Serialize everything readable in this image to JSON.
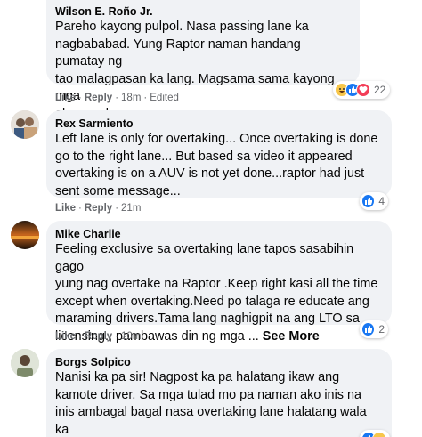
{
  "comments": [
    {
      "author": "Wilson E. Roño Jr.",
      "text": "Pareho kayong pulpol. Nasa passing lane ka\nnagbababad. Yung Raptor naman handang pumatay ng\ntao malagpasan ka lang. Magsama sama kayong mga\nabnormal",
      "actions": {
        "like": "Like",
        "reply": "Reply",
        "time": "18m",
        "edited": "Edited"
      },
      "reactions": {
        "icons": [
          "haha-icon",
          "like-icon",
          "love-icon"
        ],
        "count": "22"
      }
    },
    {
      "author": "Rex Sarmiento",
      "text": "Left lane is only for overtaking... Once overtaking is done\ngo to the right lane... But based sa video it appeared\novertaking is on a AUV is not yet done...raptor had just\nsent some message...",
      "actions": {
        "like": "Like",
        "reply": "Reply",
        "time": "21m"
      },
      "reactions": {
        "icons": [
          "like-icon"
        ],
        "count": "4"
      }
    },
    {
      "author": "Mike Charlie",
      "text": "Feeling exclusive sa overtaking lane tapos sasabihin gago\nyung nag overtake na Raptor .Keep right kasi all the time\nexcept when overtaking.Need po talaga re educate ang\nmaraming drivers.Tama lang naghigpit na ang LTO sa\nlicensing., pambawas din ng mga ... ",
      "see_more": "See More",
      "actions": {
        "like": "Like",
        "reply": "Reply",
        "time": "10m"
      },
      "reactions": {
        "icons": [
          "like-icon"
        ],
        "count": "2"
      }
    },
    {
      "author": "Borgs Solpico",
      "text": "Nanisi ka pa sir! Nagpost ka pa halatang ikaw ang\nkamote driver. Sa mga tulad mo pa naman ako inis na\ninis ambagal bagal nasa overtaking lane halatang wala ka\nroad courtesy!",
      "reactions": {
        "icons": [
          "like-icon",
          "haha-icon"
        ]
      }
    }
  ],
  "colors": {
    "bubble": "#f0f2f5",
    "meta": "#65676b",
    "like": "#1877f2",
    "haha": "#f7c64a",
    "love": "#f33e58"
  }
}
